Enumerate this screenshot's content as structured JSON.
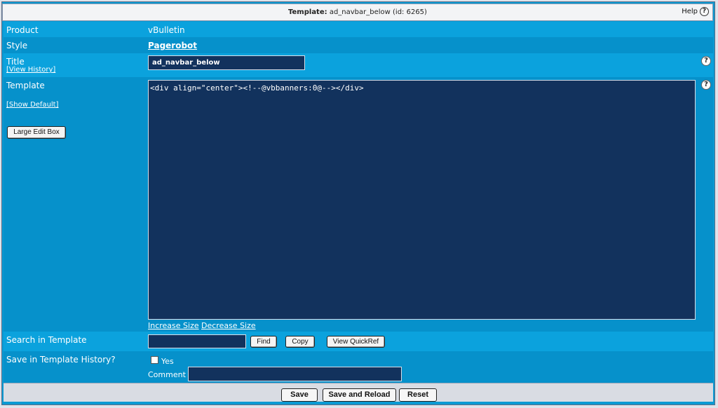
{
  "title": {
    "prefix": "Template:",
    "text": "ad_navbar_below (id: 6265)"
  },
  "help": {
    "label": "Help",
    "icon": "question-icon"
  },
  "rows": {
    "product": {
      "label": "Product",
      "value": "vBulletin"
    },
    "style": {
      "label": "Style",
      "value": "Pagerobot"
    },
    "title_row": {
      "label": "Title",
      "history_link": "[View History]",
      "input_value": "ad_navbar_below"
    },
    "template": {
      "label": "Template",
      "show_default": "[Show Default]",
      "large_edit": "Large Edit Box",
      "code": "<div align=\"center\"><!--@vbbanners:0@--></div>",
      "increase": "Increase Size",
      "decrease": "Decrease Size"
    },
    "search": {
      "label": "Search in Template",
      "input_value": "",
      "find": "Find",
      "copy": "Copy",
      "quickref": "View QuickRef"
    },
    "save_history": {
      "label": "Save in Template History?",
      "yes_label": "Yes",
      "comment_label": "Comment",
      "comment_value": ""
    }
  },
  "footer": {
    "save": "Save",
    "save_reload": "Save and Reload",
    "reset": "Reset"
  },
  "colors": {
    "panel": "#0b9ad3",
    "input_bg": "#12325d",
    "titlebar": "#f3f4f6"
  }
}
